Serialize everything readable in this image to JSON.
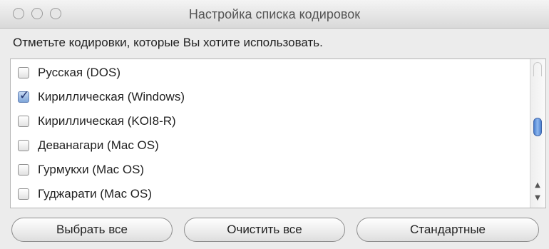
{
  "window": {
    "title": "Настройка списка кодировок"
  },
  "prompt": "Отметьте кодировки, которые Вы хотите использовать.",
  "encodings": [
    {
      "label": "Русская (DOS)",
      "checked": false
    },
    {
      "label": "Кириллическая (Windows)",
      "checked": true
    },
    {
      "label": "Кириллическая (KOI8-R)",
      "checked": false
    },
    {
      "label": "Деванагари (Mac OS)",
      "checked": false
    },
    {
      "label": "Гурмукхи (Mac OS)",
      "checked": false
    },
    {
      "label": "Гуджарати (Mac OS)",
      "checked": false
    }
  ],
  "buttons": {
    "select_all": "Выбрать все",
    "clear_all": "Очистить все",
    "defaults": "Стандартные"
  },
  "scrollbar": {
    "arrow_up": "▲",
    "arrow_down": "▼"
  },
  "colors": {
    "selected_accent": "#4a7fd0"
  }
}
